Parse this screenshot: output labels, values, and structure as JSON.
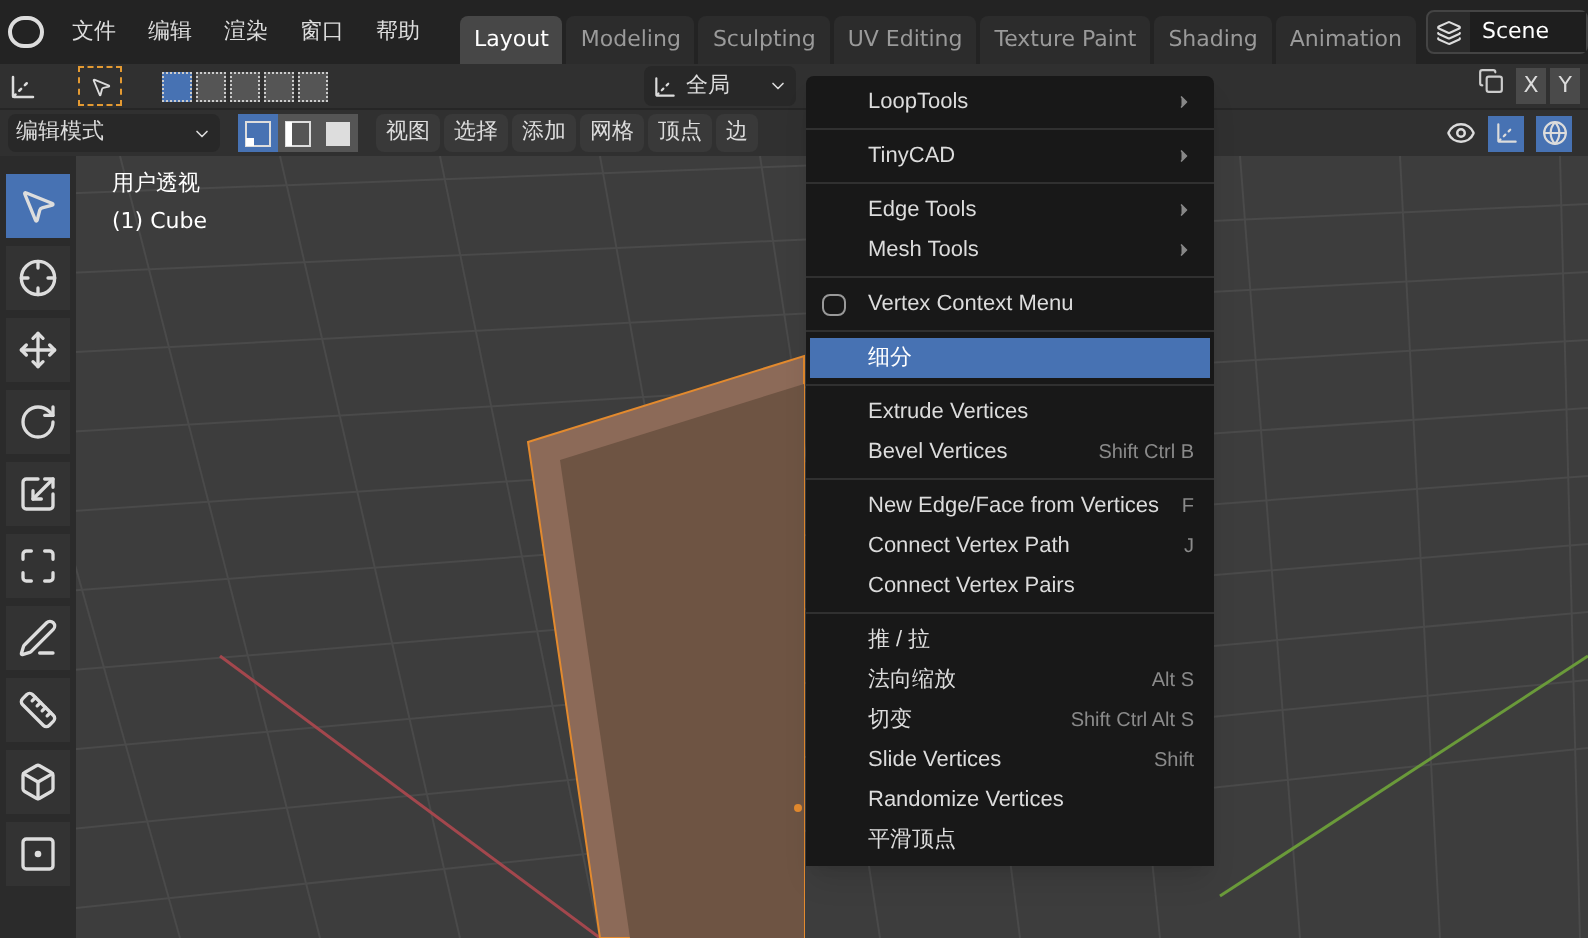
{
  "top_menu": [
    "文件",
    "编辑",
    "渲染",
    "窗口",
    "帮助"
  ],
  "workspace_tabs": [
    {
      "label": "Layout",
      "selected": true
    },
    {
      "label": "Modeling",
      "selected": false
    },
    {
      "label": "Sculpting",
      "selected": false
    },
    {
      "label": "UV Editing",
      "selected": false
    },
    {
      "label": "Texture Paint",
      "selected": false
    },
    {
      "label": "Shading",
      "selected": false
    },
    {
      "label": "Animation",
      "selected": false
    }
  ],
  "scene": "Scene",
  "transform_orientation": "全局",
  "axis_buttons": [
    "X",
    "Y"
  ],
  "mode": "编辑模式",
  "select_modes": [
    {
      "kind": "vertex",
      "selected": true
    },
    {
      "kind": "edge",
      "selected": false
    },
    {
      "kind": "face",
      "selected": false
    }
  ],
  "view_menus": [
    "视图",
    "选择",
    "添加",
    "网格",
    "顶点",
    "边"
  ],
  "viewport": {
    "view_name": "用户透视",
    "object_name": "(1) Cube"
  },
  "tools": [
    {
      "kind": "select",
      "selected": true
    },
    {
      "kind": "cursor",
      "selected": false
    },
    {
      "kind": "move",
      "selected": false
    },
    {
      "kind": "rotate",
      "selected": false
    },
    {
      "kind": "scale",
      "selected": false
    },
    {
      "kind": "transform",
      "selected": false
    },
    {
      "kind": "annotate",
      "selected": false
    },
    {
      "kind": "measure",
      "selected": false
    },
    {
      "kind": "extrude",
      "selected": false
    },
    {
      "kind": "inset",
      "selected": false
    }
  ],
  "context_menu": [
    {
      "kind": "submenu",
      "label": "LoopTools",
      "selected": false
    },
    {
      "kind": "separator"
    },
    {
      "kind": "submenu",
      "label": "TinyCAD",
      "selected": false
    },
    {
      "kind": "separator"
    },
    {
      "kind": "submenu",
      "label": "Edge Tools",
      "selected": false
    },
    {
      "kind": "submenu",
      "label": "Mesh Tools",
      "selected": false
    },
    {
      "kind": "separator"
    },
    {
      "kind": "menu_icon",
      "label": "Vertex Context Menu",
      "selected": false
    },
    {
      "kind": "separator"
    },
    {
      "kind": "action",
      "label": "细分",
      "selected": true
    },
    {
      "kind": "separator"
    },
    {
      "kind": "action",
      "label": "Extrude Vertices",
      "selected": false
    },
    {
      "kind": "action",
      "label": "Bevel Vertices",
      "shortcut": "Shift Ctrl B",
      "selected": false
    },
    {
      "kind": "separator"
    },
    {
      "kind": "action",
      "label": "New Edge/Face from Vertices",
      "shortcut": "F",
      "selected": false
    },
    {
      "kind": "action",
      "label": "Connect Vertex Path",
      "shortcut": "J",
      "selected": false
    },
    {
      "kind": "action",
      "label": "Connect Vertex Pairs",
      "selected": false
    },
    {
      "kind": "separator"
    },
    {
      "kind": "action",
      "label": "推 / 拉",
      "selected": false
    },
    {
      "kind": "action",
      "label": "法向缩放",
      "shortcut": "Alt S",
      "selected": false
    },
    {
      "kind": "action",
      "label": "切变",
      "shortcut": "Shift Ctrl Alt S",
      "selected": false
    },
    {
      "kind": "action",
      "label": "Slide Vertices",
      "shortcut": "Shift",
      "selected": false
    },
    {
      "kind": "action",
      "label": "Randomize Vertices",
      "selected": false
    },
    {
      "kind": "action",
      "label": "平滑顶点",
      "selected": false
    }
  ]
}
